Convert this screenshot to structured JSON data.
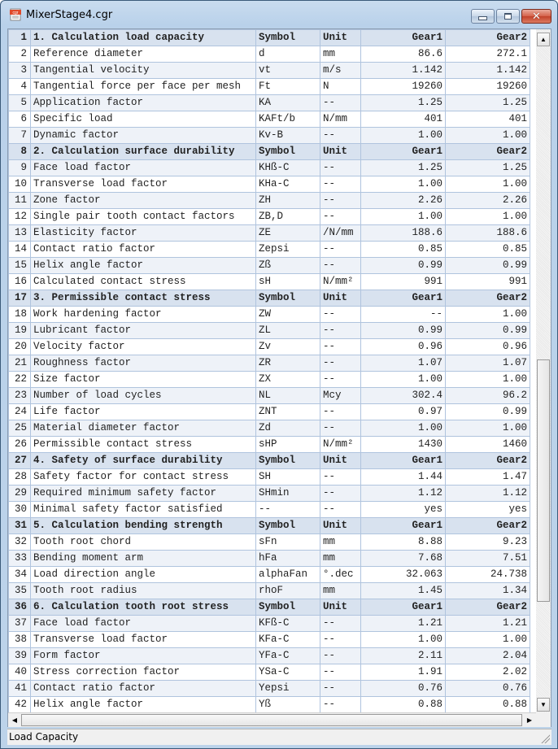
{
  "window": {
    "title": "MixerStage4.cgr",
    "icon": "cgr-document-icon",
    "controls": {
      "minimize": "minimize-icon",
      "maximize": "maximize-icon",
      "close": "close-icon"
    },
    "close_glyph": "✕"
  },
  "scrollbar": {
    "up": "▲",
    "down": "▼",
    "left": "◀",
    "right": "▶"
  },
  "status_bar": {
    "text": "Load Capacity"
  },
  "table": {
    "rows": [
      {
        "n": "1",
        "d": "1. Calculation load capacity",
        "s": "Symbol",
        "u": "Unit",
        "g1": "Gear1",
        "g2": "Gear2",
        "type": "hdr"
      },
      {
        "n": "2",
        "d": "Reference diameter",
        "s": "d",
        "u": "mm",
        "g1": "86.6",
        "g2": "272.1",
        "type": "row"
      },
      {
        "n": "3",
        "d": "Tangential velocity",
        "s": "vt",
        "u": "m/s",
        "g1": "1.142",
        "g2": "1.142",
        "type": "alt"
      },
      {
        "n": "4",
        "d": "Tangential force per face per mesh",
        "s": "Ft",
        "u": "N",
        "g1": "19260",
        "g2": "19260",
        "type": "row"
      },
      {
        "n": "5",
        "d": "Application factor",
        "s": "KA",
        "u": "--",
        "g1": "1.25",
        "g2": "1.25",
        "type": "alt"
      },
      {
        "n": "6",
        "d": "Specific load",
        "s": "KAFt/b",
        "u": "N/mm",
        "g1": "401",
        "g2": "401",
        "type": "row"
      },
      {
        "n": "7",
        "d": "Dynamic factor",
        "s": "Kv-B",
        "u": "--",
        "g1": "1.00",
        "g2": "1.00",
        "type": "alt"
      },
      {
        "n": "8",
        "d": "2. Calculation surface durability",
        "s": "Symbol",
        "u": "Unit",
        "g1": "Gear1",
        "g2": "Gear2",
        "type": "hdr"
      },
      {
        "n": "9",
        "d": "Face load factor",
        "s": "KHß-C",
        "u": "--",
        "g1": "1.25",
        "g2": "1.25",
        "type": "alt"
      },
      {
        "n": "10",
        "d": "Transverse load factor",
        "s": "KHa-C",
        "u": "--",
        "g1": "1.00",
        "g2": "1.00",
        "type": "row"
      },
      {
        "n": "11",
        "d": "Zone factor",
        "s": "ZH",
        "u": "--",
        "g1": "2.26",
        "g2": "2.26",
        "type": "alt"
      },
      {
        "n": "12",
        "d": "Single pair tooth contact factors",
        "s": "ZB,D",
        "u": "--",
        "g1": "1.00",
        "g2": "1.00",
        "type": "row"
      },
      {
        "n": "13",
        "d": "Elasticity factor",
        "s": "ZE",
        "u": "/N/mm",
        "g1": "188.6",
        "g2": "188.6",
        "type": "alt"
      },
      {
        "n": "14",
        "d": "Contact ratio factor",
        "s": "Zepsi",
        "u": "--",
        "g1": "0.85",
        "g2": "0.85",
        "type": "row"
      },
      {
        "n": "15",
        "d": "Helix angle factor",
        "s": "Zß",
        "u": "--",
        "g1": "0.99",
        "g2": "0.99",
        "type": "alt"
      },
      {
        "n": "16",
        "d": "Calculated contact stress",
        "s": "sH",
        "u": "N/mm²",
        "g1": "991",
        "g2": "991",
        "type": "row"
      },
      {
        "n": "17",
        "d": "3. Permissible contact stress",
        "s": "Symbol",
        "u": "Unit",
        "g1": "Gear1",
        "g2": "Gear2",
        "type": "hdr"
      },
      {
        "n": "18",
        "d": "Work hardening factor",
        "s": "ZW",
        "u": "--",
        "g1": "--",
        "g2": "1.00",
        "type": "row"
      },
      {
        "n": "19",
        "d": "Lubricant factor",
        "s": "ZL",
        "u": "--",
        "g1": "0.99",
        "g2": "0.99",
        "type": "alt"
      },
      {
        "n": "20",
        "d": "Velocity factor",
        "s": "Zv",
        "u": "--",
        "g1": "0.96",
        "g2": "0.96",
        "type": "row"
      },
      {
        "n": "21",
        "d": "Roughness factor",
        "s": "ZR",
        "u": "--",
        "g1": "1.07",
        "g2": "1.07",
        "type": "alt"
      },
      {
        "n": "22",
        "d": "Size factor",
        "s": "ZX",
        "u": "--",
        "g1": "1.00",
        "g2": "1.00",
        "type": "row"
      },
      {
        "n": "23",
        "d": "Number of load cycles",
        "s": "NL",
        "u": "Mcy",
        "g1": "302.4",
        "g2": "96.2",
        "type": "alt"
      },
      {
        "n": "24",
        "d": "Life factor",
        "s": "ZNT",
        "u": "--",
        "g1": "0.97",
        "g2": "0.99",
        "type": "row"
      },
      {
        "n": "25",
        "d": "Material diameter factor",
        "s": "Zd",
        "u": "--",
        "g1": "1.00",
        "g2": "1.00",
        "type": "alt"
      },
      {
        "n": "26",
        "d": "Permissible contact stress",
        "s": "sHP",
        "u": "N/mm²",
        "g1": "1430",
        "g2": "1460",
        "type": "row"
      },
      {
        "n": "27",
        "d": "4. Safety of surface durability",
        "s": "Symbol",
        "u": "Unit",
        "g1": "Gear1",
        "g2": "Gear2",
        "type": "hdr"
      },
      {
        "n": "28",
        "d": "Safety factor for contact stress",
        "s": "SH",
        "u": "--",
        "g1": "1.44",
        "g2": "1.47",
        "type": "row"
      },
      {
        "n": "29",
        "d": "Required minimum safety factor",
        "s": "SHmin",
        "u": "--",
        "g1": "1.12",
        "g2": "1.12",
        "type": "alt"
      },
      {
        "n": "30",
        "d": "Minimal safety factor satisfied",
        "s": "--",
        "u": "--",
        "g1": "yes",
        "g2": "yes",
        "type": "row"
      },
      {
        "n": "31",
        "d": "5. Calculation bending strength",
        "s": "Symbol",
        "u": "Unit",
        "g1": "Gear1",
        "g2": "Gear2",
        "type": "hdr"
      },
      {
        "n": "32",
        "d": "Tooth root chord",
        "s": "sFn",
        "u": "mm",
        "g1": "8.88",
        "g2": "9.23",
        "type": "row"
      },
      {
        "n": "33",
        "d": "Bending moment arm",
        "s": "hFa",
        "u": "mm",
        "g1": "7.68",
        "g2": "7.51",
        "type": "alt"
      },
      {
        "n": "34",
        "d": "Load direction angle",
        "s": "alphaFan",
        "u": "°.dec",
        "g1": "32.063",
        "g2": "24.738",
        "type": "row"
      },
      {
        "n": "35",
        "d": "Tooth root radius",
        "s": "rhoF",
        "u": "mm",
        "g1": "1.45",
        "g2": "1.34",
        "type": "alt"
      },
      {
        "n": "36",
        "d": "6. Calculation tooth root stress",
        "s": "Symbol",
        "u": "Unit",
        "g1": "Gear1",
        "g2": "Gear2",
        "type": "hdr"
      },
      {
        "n": "37",
        "d": "Face load factor",
        "s": "KFß-C",
        "u": "--",
        "g1": "1.21",
        "g2": "1.21",
        "type": "alt"
      },
      {
        "n": "38",
        "d": "Transverse load factor",
        "s": "KFa-C",
        "u": "--",
        "g1": "1.00",
        "g2": "1.00",
        "type": "row"
      },
      {
        "n": "39",
        "d": "Form factor",
        "s": "YFa-C",
        "u": "--",
        "g1": "2.11",
        "g2": "2.04",
        "type": "alt"
      },
      {
        "n": "40",
        "d": "Stress correction factor",
        "s": "YSa-C",
        "u": "--",
        "g1": "1.91",
        "g2": "2.02",
        "type": "row"
      },
      {
        "n": "41",
        "d": "Contact ratio factor",
        "s": "Yepsi",
        "u": "--",
        "g1": "0.76",
        "g2": "0.76",
        "type": "alt"
      },
      {
        "n": "42",
        "d": "Helix angle factor",
        "s": "Yß",
        "u": "--",
        "g1": "0.88",
        "g2": "0.88",
        "type": "row"
      }
    ]
  }
}
